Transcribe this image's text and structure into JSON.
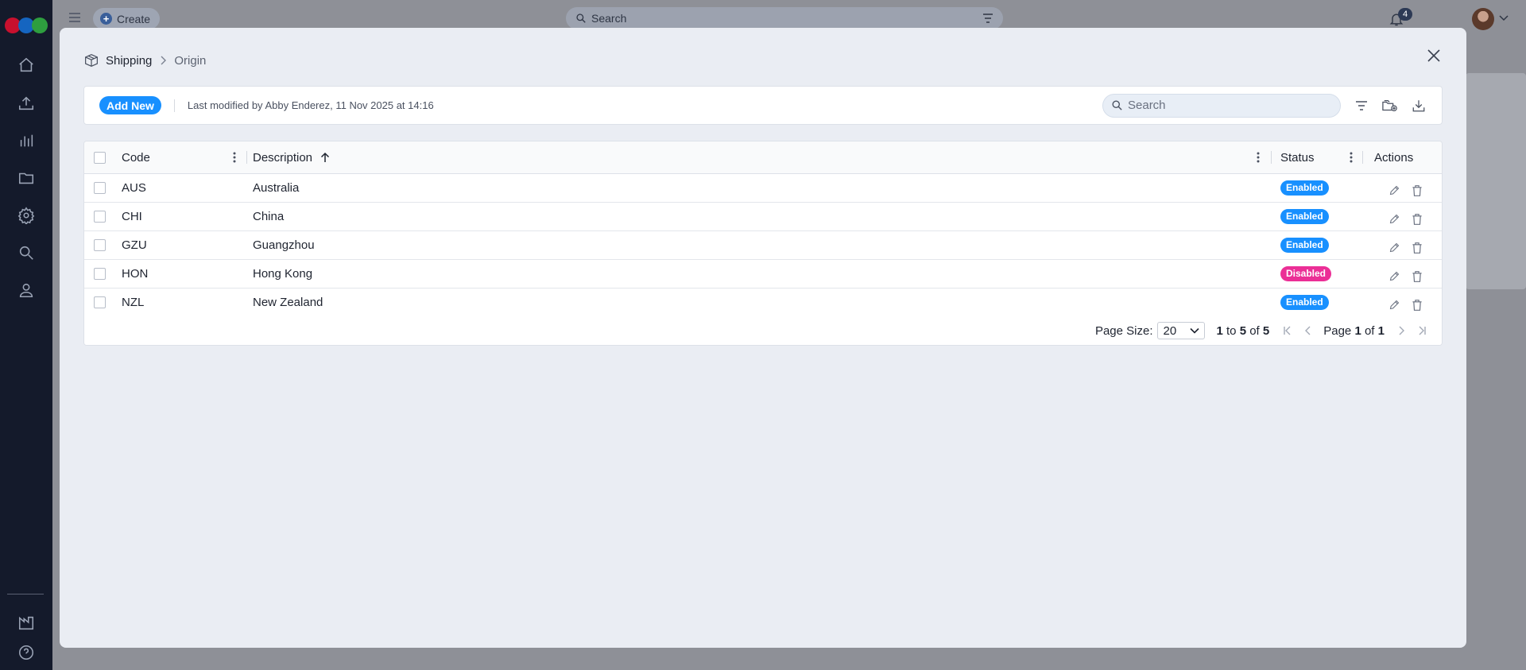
{
  "app": {
    "create_label": "Create",
    "search_placeholder": "Search",
    "notification_count": "4"
  },
  "sidebar": {
    "items": [
      {
        "name": "home-icon"
      },
      {
        "name": "upload-icon"
      },
      {
        "name": "chart-icon"
      },
      {
        "name": "folder-icon"
      },
      {
        "name": "gear-icon"
      },
      {
        "name": "search-icon"
      },
      {
        "name": "user-icon"
      },
      {
        "name": "factory-icon"
      },
      {
        "name": "help-icon"
      }
    ]
  },
  "modal": {
    "breadcrumb": {
      "root": "Shipping",
      "current": "Origin"
    },
    "toolbar": {
      "add_label": "Add New",
      "modified_text": "Last modified by Abby Enderez, 11 Nov 2025 at 14:16",
      "search_placeholder": "Search"
    },
    "grid": {
      "columns": {
        "code": "Code",
        "description": "Description",
        "status": "Status",
        "actions": "Actions"
      },
      "rows": [
        {
          "code": "AUS",
          "description": "Australia",
          "status": "Enabled"
        },
        {
          "code": "CHI",
          "description": "China",
          "status": "Enabled"
        },
        {
          "code": "GZU",
          "description": "Guangzhou",
          "status": "Enabled"
        },
        {
          "code": "HON",
          "description": "Hong Kong",
          "status": "Disabled"
        },
        {
          "code": "NZL",
          "description": "New Zealand",
          "status": "Enabled"
        }
      ]
    },
    "pagination": {
      "page_size_label": "Page Size:",
      "page_size": "20",
      "from": "1",
      "to_label": "to",
      "to": "5",
      "of_label": "of",
      "total": "5",
      "page_label": "Page",
      "page": "1",
      "pages": "1"
    }
  },
  "colors": {
    "accent": "#1890ff",
    "disabled": "#eb2f96",
    "rail": "#141a2b"
  }
}
